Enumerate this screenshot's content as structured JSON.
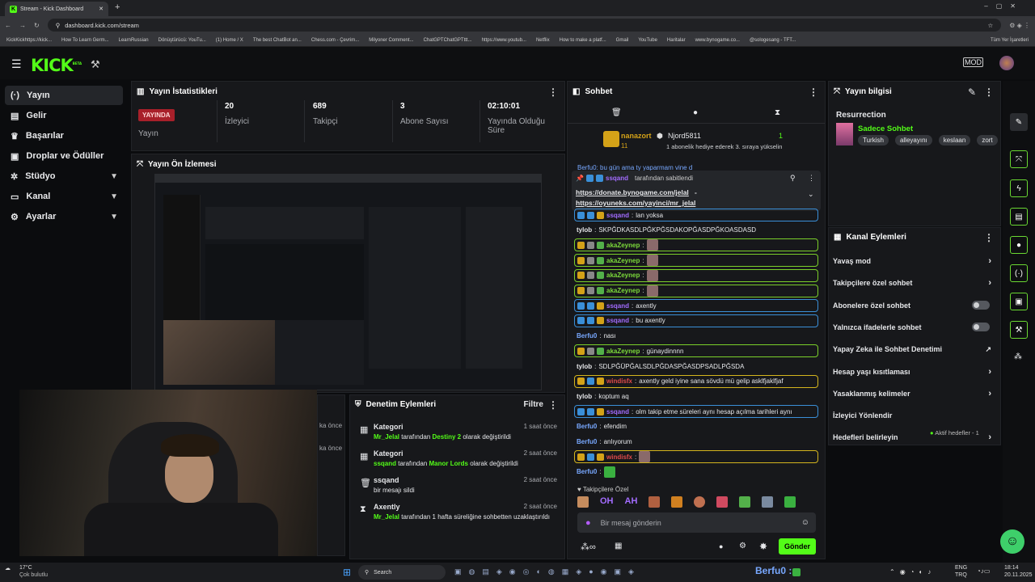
{
  "browser": {
    "tab_title": "Stream - Kick Dashboard",
    "new_tab": "+",
    "url": "dashboard.kick.com/stream",
    "bookmarks": [
      "KickKickhttps://kick...",
      "How To Learn Germ...",
      "LearnRussian",
      "Dönüştürücü: YouTu...",
      "(1) Home / X",
      "The best ChatBot an...",
      "Chess.com - Çevrim...",
      "Milyoner Comment...",
      "ChatGPTChatGPTttt...",
      "https://www.youtub...",
      "Netflix",
      "How to make a platf...",
      "Gmail",
      "YouTube",
      "Haritalar",
      "www.bynogame.co...",
      "@sologesang - TFT..."
    ],
    "all_bookmarks": "Tüm Yer İşaretleri"
  },
  "app": {
    "logo": "KICK",
    "logo_sup": "BETA",
    "accent": "#53fc18"
  },
  "sidebar": {
    "items": [
      {
        "label": "Yayın",
        "icon": "broadcast-icon"
      },
      {
        "label": "Gelir",
        "icon": "money-icon"
      },
      {
        "label": "Başarılar",
        "icon": "trophy-icon"
      },
      {
        "label": "Droplar ve Ödüller",
        "icon": "gift-icon"
      },
      {
        "label": "Stüdyo",
        "icon": "studio-icon"
      },
      {
        "label": "Kanal",
        "icon": "channel-icon"
      },
      {
        "label": "Ayarlar",
        "icon": "gear-icon"
      }
    ]
  },
  "stats": {
    "title": "Yayın İstatistikleri",
    "live_badge": "YAYINDA",
    "live_label": "Yayın",
    "viewers_value": "20",
    "viewers_label": "İzleyici",
    "followers_value": "689",
    "followers_label": "Takipçi",
    "subs_value": "3",
    "subs_label": "Abone Sayısı",
    "uptime_value": "02:10:01",
    "uptime_label": "Yayında Olduğu Süre"
  },
  "preview": {
    "title": "Yayın Ön İzlemesi"
  },
  "modlog": {
    "title": "Denetim Eylemleri",
    "filter": "Filtre",
    "ghost_times": [
      "ka önce",
      "ka önce"
    ],
    "entries": [
      {
        "title": "Kategori",
        "user": "Mr_Jelal",
        "mid": "tarafından",
        "target": "Destiny 2",
        "rest": "olarak değiştirildi",
        "time": "1 saat önce"
      },
      {
        "title": "Kategori",
        "user": "ssqand",
        "mid": "tarafından",
        "target": "Manor Lords",
        "rest": "olarak değiştirildi",
        "time": "2 saat önce"
      },
      {
        "title": "ssqand",
        "line": "bir mesajı sildi",
        "time": "2 saat önce"
      },
      {
        "title": "Axently",
        "user": "Mr_Jelal",
        "rest": "tarafından 1 hafta süreliğine sohbetten uzaklaştırıldı",
        "time": "2 saat önce"
      }
    ]
  },
  "chat": {
    "title": "Sohbet",
    "sub_user": "nanazort",
    "sub_months": "11",
    "gift_user": "Njord5811",
    "gift_count": "1",
    "gift_text": "1 abonelik hediye ederek 3. sıraya yükselin",
    "partial": "Berfu0: bu gün ama ty yaparmam vine d",
    "pinned_by": "ssqand",
    "pinned_suffix": "tarafından sabitlendi",
    "pinned_link1": "https://donate.bynogame.com/jelal",
    "pinned_dash": "-",
    "pinned_link2": "https://oyuneks.com/yayinci/mr_jelal",
    "messages": [
      {
        "user": "ssqand",
        "text": "lan yoksa",
        "cls": "u5",
        "hl": "hl-b"
      },
      {
        "user": "tylob",
        "text": "SKPĞDKASDLPĞKPĞSDAKOPĞASDPĞKOASDASD",
        "cls": "u4",
        "hl": ""
      },
      {
        "user": "akaZeynep",
        "text": "",
        "cls": "u2",
        "hl": "hl-g"
      },
      {
        "user": "akaZeynep",
        "text": "",
        "cls": "u2",
        "hl": "hl-g"
      },
      {
        "user": "akaZeynep",
        "text": "",
        "cls": "u2",
        "hl": "hl-g"
      },
      {
        "user": "akaZeynep",
        "text": "",
        "cls": "u2",
        "hl": "hl-g"
      },
      {
        "user": "ssqand",
        "text": "axently",
        "cls": "u5",
        "hl": "hl-b"
      },
      {
        "user": "ssqand",
        "text": "bu axently",
        "cls": "u5",
        "hl": "hl-b"
      },
      {
        "user": "Berfu0",
        "text": "nası",
        "cls": "u1",
        "hl": ""
      },
      {
        "user": "akaZeynep",
        "text": "günaydinnnn",
        "cls": "u2",
        "hl": "hl-g"
      },
      {
        "user": "tylob",
        "text": "SDLPĞÜPĞALSDLPĞDASPĞASDPSADLPĞSDA",
        "cls": "u4",
        "hl": ""
      },
      {
        "user": "windisfx",
        "text": "axently geld iyine sana sövdü mü gelip asklfjaklfjaf",
        "cls": "u3",
        "hl": "hl-y"
      },
      {
        "user": "tylob",
        "text": "koptum aq",
        "cls": "u4",
        "hl": ""
      },
      {
        "user": "ssqand",
        "text": "olm takip etme süreleri aynı hesap açılma tarihleri aynı",
        "cls": "u5",
        "hl": "hl-b"
      },
      {
        "user": "Berfu0",
        "text": "efendim",
        "cls": "u1",
        "hl": ""
      },
      {
        "user": "Berfu0",
        "text": "anlıyorum",
        "cls": "u1",
        "hl": ""
      },
      {
        "user": "windisfx",
        "text": "",
        "cls": "u3",
        "hl": "hl-y"
      },
      {
        "user": "Berfu0",
        "text": "",
        "cls": "u1",
        "hl": ""
      }
    ],
    "emote_section": "Takipçilere Özel",
    "input_placeholder": "Bir mesaj gönderin",
    "send": "Gönder",
    "colon": ":"
  },
  "info": {
    "title": "Yayın bilgisi",
    "stream_title": "Resurrection",
    "category": "Sadece Sohbet",
    "tags": [
      "Turkish",
      "alleyayını",
      "keslaan",
      "zort"
    ]
  },
  "actions": {
    "title": "Kanal Eylemleri",
    "items": [
      {
        "label": "Yavaş mod",
        "kind": "chevron"
      },
      {
        "label": "Takipçilere özel sohbet",
        "kind": "chevron"
      },
      {
        "label": "Abonelere özel sohbet",
        "kind": "toggle"
      },
      {
        "label": "Yalnızca ifadelerle sohbet",
        "kind": "toggle"
      },
      {
        "label": "Yapay Zeka ile Sohbet Denetimi",
        "kind": "external"
      },
      {
        "label": "Hesap yaşı kısıtlaması",
        "kind": "chevron"
      },
      {
        "label": "Yasaklanmış kelimeler",
        "kind": "chevron"
      },
      {
        "label": "İzleyici Yönlendir",
        "kind": "none"
      },
      {
        "label": "Hedefleri belirleyin",
        "kind": "chevron"
      }
    ],
    "goals_status": "Aktif hedefler - 1"
  },
  "taskbar": {
    "temp": "17°C",
    "weather": "Çok bulutlu",
    "search": "Search",
    "overlay_name": "Berfu0 :",
    "lang": "ENG",
    "region": "TRQ",
    "time": "18:14",
    "date": "20.11.2025"
  }
}
